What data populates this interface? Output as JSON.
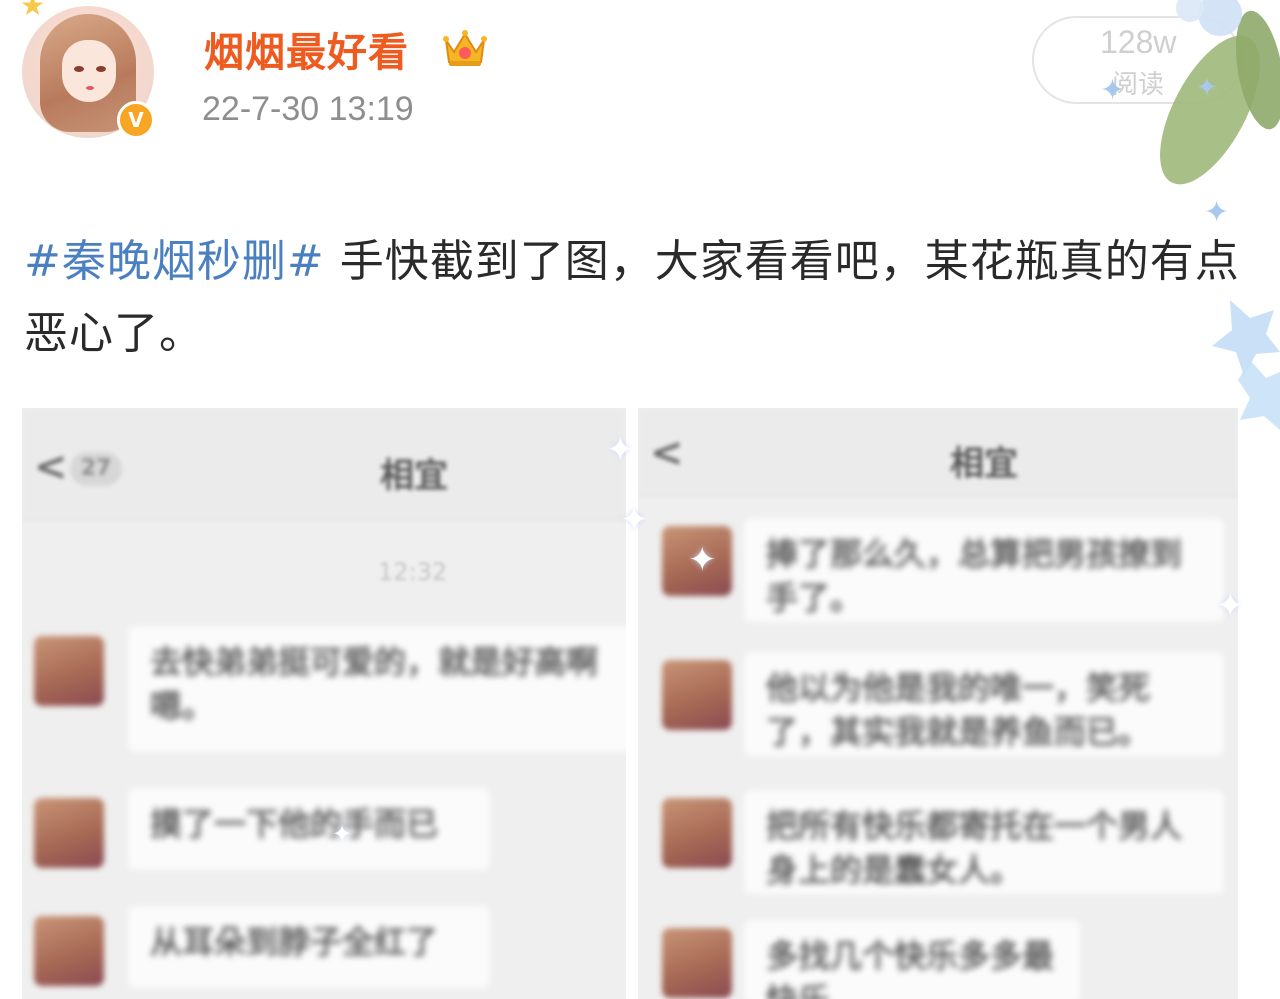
{
  "header": {
    "username": "烟烟最好看",
    "timestamp": "22-7-30 13:19",
    "reads_count": "128w",
    "reads_label": "阅读",
    "verified_badge": "V"
  },
  "post": {
    "hashtag": "#秦晚烟秒删#",
    "text": " 手快截到了图，大家看看吧，某花瓶真的有点恶心了。"
  },
  "screenshots": {
    "left": {
      "back_count": "27",
      "title": "相宜",
      "time": "12:32",
      "messages": [
        "去快弟弟挺可爱的，就是好高啊嗯。",
        "摸了一下他的手而已",
        "从耳朵到脖子全红了"
      ]
    },
    "right": {
      "title": "相宜",
      "messages": [
        "捧了那么久，总算把男孩撩到手了。",
        "他以为他是我的唯一，笑死了，其实我就是养鱼而已。",
        "把所有快乐都寄托在一个男人身上的是蠢女人。",
        "多找几个快乐多多最快乐"
      ]
    }
  },
  "colors": {
    "username": "#ef5a1e",
    "hashtag": "#4a7fc1",
    "timestamp": "#8e8e8e",
    "badge": "#f6a623"
  }
}
